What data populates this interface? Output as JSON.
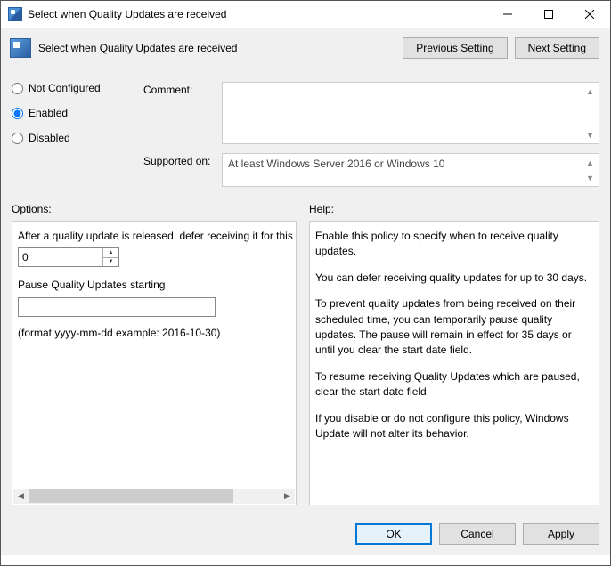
{
  "window": {
    "title": "Select when Quality Updates are received"
  },
  "header": {
    "title": "Select when Quality Updates are received",
    "prev": "Previous Setting",
    "next": "Next Setting"
  },
  "radios": {
    "not_configured": "Not Configured",
    "enabled": "Enabled",
    "disabled": "Disabled",
    "selected": "enabled"
  },
  "comment": {
    "label": "Comment:",
    "value": ""
  },
  "supported": {
    "label": "Supported on:",
    "value": "At least Windows Server 2016 or Windows 10"
  },
  "sections": {
    "options": "Options:",
    "help": "Help:"
  },
  "options": {
    "defer_label": "After a quality update is released, defer receiving it for this many days:",
    "defer_value": "0",
    "pause_label": "Pause Quality Updates starting",
    "pause_value": "",
    "format_hint": "(format yyyy-mm-dd example: 2016-10-30)"
  },
  "help": {
    "p1": "Enable this policy to specify when to receive quality updates.",
    "p2": "You can defer receiving quality updates for up to 30 days.",
    "p3": "To prevent quality updates from being received on their scheduled time, you can temporarily pause quality updates. The pause will remain in effect for 35 days or until you clear the start date field.",
    "p4": "To resume receiving Quality Updates which are paused, clear the start date field.",
    "p5": "If you disable or do not configure this policy, Windows Update will not alter its behavior."
  },
  "footer": {
    "ok": "OK",
    "cancel": "Cancel",
    "apply": "Apply"
  }
}
